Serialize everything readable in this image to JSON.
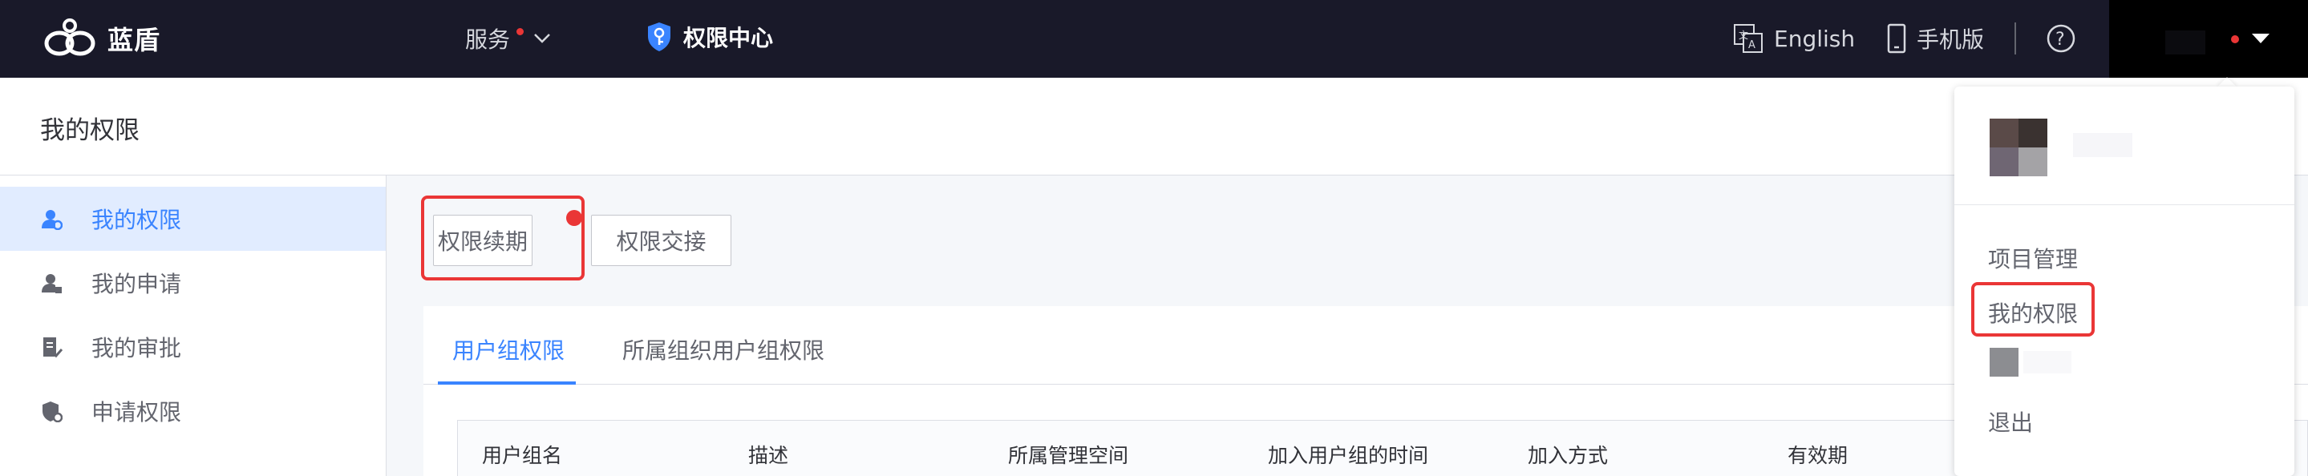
{
  "topbar": {
    "brand": "蓝盾",
    "service_label": "服务",
    "current_app": "权限中心",
    "language_label": "English",
    "mobile_label": "手机版"
  },
  "header": {
    "title": "我的权限"
  },
  "sidebar": {
    "items": [
      {
        "label": "我的权限",
        "icon": "user-permission-icon",
        "active": true
      },
      {
        "label": "我的申请",
        "icon": "user-apply-icon",
        "active": false
      },
      {
        "label": "我的审批",
        "icon": "approval-doc-icon",
        "active": false
      },
      {
        "label": "申请权限",
        "icon": "shield-key-icon",
        "active": false
      }
    ]
  },
  "actions": {
    "renew_label": "权限续期",
    "transfer_label": "权限交接"
  },
  "tabs": [
    {
      "label": "用户组权限",
      "active": true
    },
    {
      "label": "所属组织用户组权限",
      "active": false
    }
  ],
  "table": {
    "columns": [
      "用户组名",
      "描述",
      "所属管理空间",
      "加入用户组的时间",
      "加入方式",
      "有效期"
    ]
  },
  "user_menu": {
    "items": [
      "项目管理",
      "我的权限",
      "退出"
    ]
  },
  "colors": {
    "topbar_bg": "#191929",
    "accent": "#3a84ff",
    "highlight": "#ea3636"
  }
}
